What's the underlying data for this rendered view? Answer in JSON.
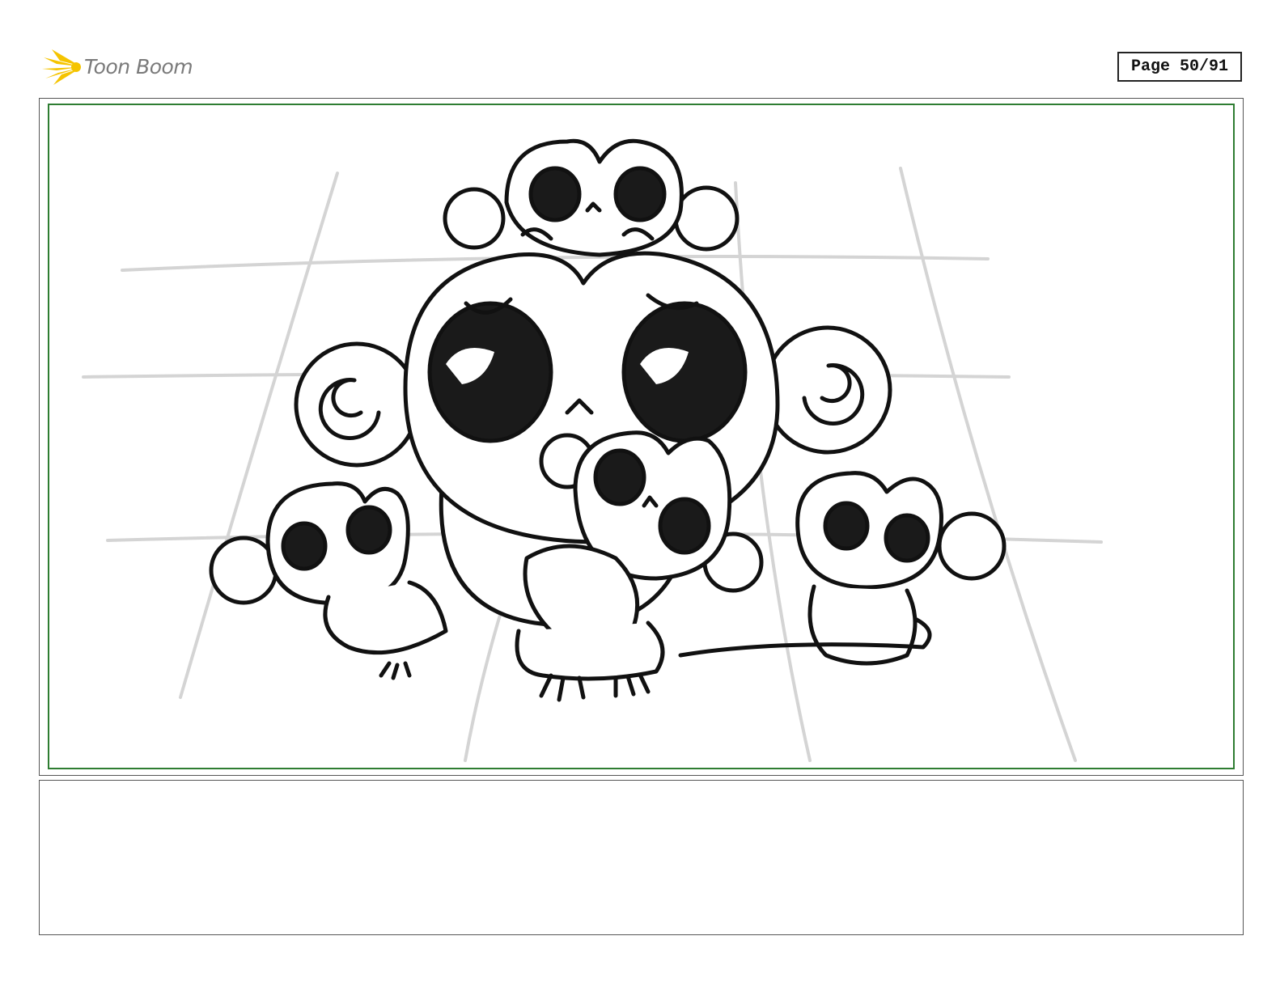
{
  "header": {
    "brand": "Toon Boom",
    "page_label": "Page 50/91"
  },
  "colors": {
    "frame_border": "#2e7d32",
    "logo_yellow": "#f5c400",
    "ink": "#111111",
    "guide_lines": "#d0d0d0"
  },
  "panel": {
    "image": "monkey-family-sketch"
  },
  "notes": {
    "text": ""
  }
}
